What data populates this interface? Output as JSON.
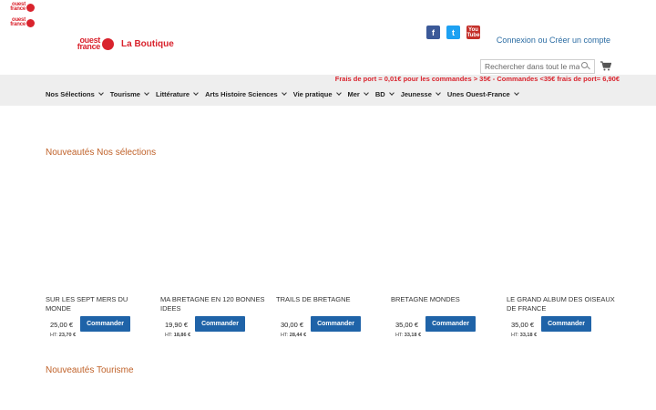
{
  "header": {
    "logo_small_text": "ouest france",
    "brand_logo_text": "ouest france",
    "brand_name": "La Boutique",
    "social": [
      {
        "name": "facebook-icon",
        "glyph": "f"
      },
      {
        "name": "twitter-icon",
        "glyph": "t"
      },
      {
        "name": "youtube-icon",
        "glyph": "You Tube"
      }
    ],
    "account": {
      "login": "Connexion",
      "or": "ou",
      "register": "Créer un compte"
    },
    "search_placeholder": "Rechercher dans tout le magasin...",
    "shipping_notice": "Frais de port = 0,01€ pour les commandes > 35€ - Commandes <35€ frais de port= 6,90€"
  },
  "nav": [
    {
      "label": "Nos Sélections"
    },
    {
      "label": "Tourisme"
    },
    {
      "label": "Littérature"
    },
    {
      "label": "Arts Histoire Sciences"
    },
    {
      "label": "Vie pratique"
    },
    {
      "label": "Mer"
    },
    {
      "label": "BD"
    },
    {
      "label": "Jeunesse"
    },
    {
      "label": "Unes Ouest-France"
    }
  ],
  "sections": [
    {
      "title": "Nouveautés Nos sélections",
      "products": [
        {
          "name": "SUR LES SEPT MERS DU MONDE",
          "price": "25,00 €",
          "ht_label": "HT:",
          "ht": "23,70 €",
          "button": "Commander"
        },
        {
          "name": "MA BRETAGNE EN 120 BONNES IDEES",
          "price": "19,90 €",
          "ht_label": "HT:",
          "ht": "18,86 €",
          "button": "Commander"
        },
        {
          "name": "TRAILS DE BRETAGNE",
          "price": "30,00 €",
          "ht_label": "HT:",
          "ht": "28,44 €",
          "button": "Commander"
        },
        {
          "name": "BRETAGNE MONDES",
          "price": "35,00 €",
          "ht_label": "HT:",
          "ht": "33,18 €",
          "button": "Commander"
        },
        {
          "name": "LE GRAND ALBUM DES OISEAUX DE FRANCE",
          "price": "35,00 €",
          "ht_label": "HT:",
          "ht": "33,18 €",
          "button": "Commander"
        }
      ]
    },
    {
      "title": "Nouveautés Tourisme",
      "products": []
    }
  ],
  "colors": {
    "brand_red": "#d9232d",
    "link_blue": "#2b6ca3",
    "button_blue": "#1f63a8",
    "section_orange": "#c0622a"
  }
}
